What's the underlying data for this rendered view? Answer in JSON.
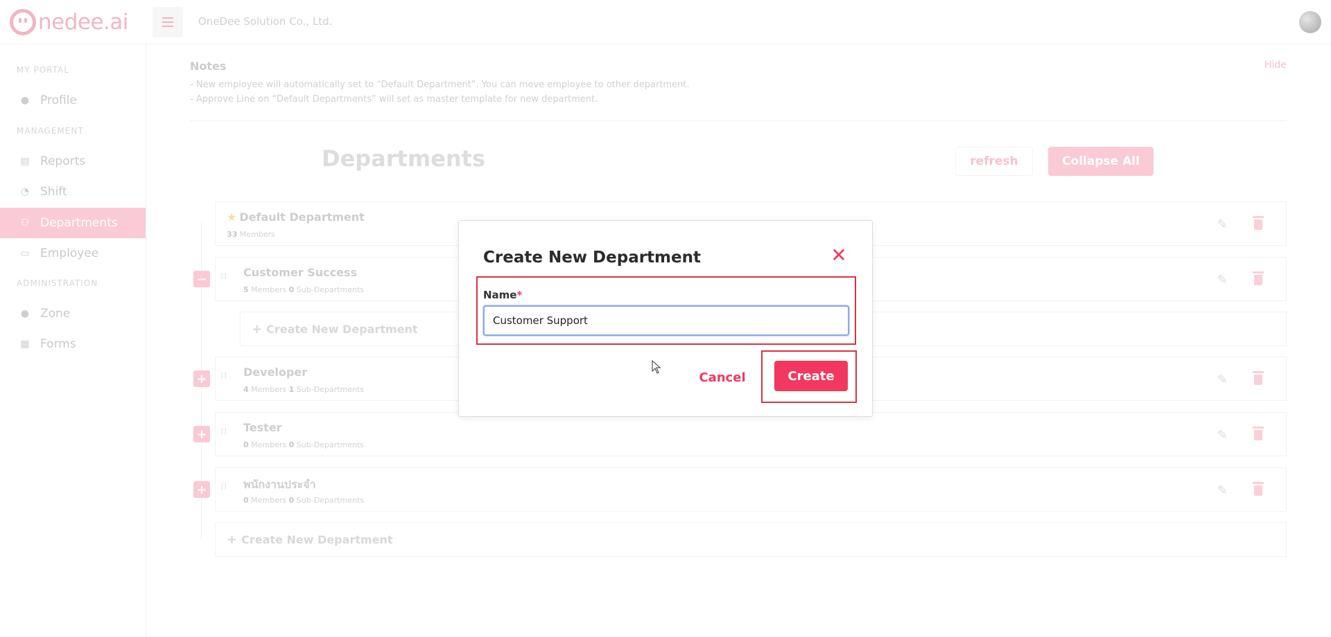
{
  "topbar": {
    "logo_text": "nedee.ai",
    "company_name": "OneDee Solution Co., Ltd."
  },
  "sidebar": {
    "sections": [
      {
        "label": "MY PORTAL",
        "items": [
          {
            "label": "Profile",
            "icon": "user-circle-icon"
          }
        ]
      },
      {
        "label": "MANAGEMENT",
        "items": [
          {
            "label": "Reports",
            "icon": "document-icon"
          },
          {
            "label": "Shift",
            "icon": "shift-icon"
          },
          {
            "label": "Departments",
            "icon": "users-icon",
            "active": true
          },
          {
            "label": "Employee",
            "icon": "id-card-icon"
          }
        ]
      },
      {
        "label": "ADMINISTRATION",
        "items": [
          {
            "label": "Zone",
            "icon": "pin-icon"
          },
          {
            "label": "Forms",
            "icon": "clipboard-icon"
          }
        ]
      }
    ]
  },
  "notes": {
    "title": "Notes",
    "hide_label": "Hide",
    "lines": [
      "- New employee will automatically set to “Default Department”. You can move employee to other department.",
      "- Approve Line on “Default Departments” will set as master template for new department."
    ]
  },
  "departments": {
    "heading": "Departments",
    "refresh_label": "refresh",
    "collapse_all_label": "Collapse All",
    "default": {
      "name": "Default Department",
      "members": "33",
      "members_label": "Members"
    },
    "rows": [
      {
        "name": "Customer Success",
        "members": "5",
        "sub": "0",
        "expanded": true
      },
      {
        "name": "Developer",
        "members": "4",
        "sub": "1",
        "expanded": false
      },
      {
        "name": "Tester",
        "members": "0",
        "sub": "0",
        "expanded": false
      },
      {
        "name": "พนักงานประจำ",
        "members": "0",
        "sub": "0",
        "expanded": false
      }
    ],
    "members_label": "Members",
    "sub_label": "Sub-Departments",
    "create_new_label": "Create New Department"
  },
  "modal": {
    "title": "Create New Department",
    "name_label": "Name",
    "required_mark": "*",
    "name_value": "Customer Support",
    "cancel_label": "Cancel",
    "create_label": "Create"
  },
  "colors": {
    "accent": "#f2385e",
    "accent_dimmed": "#f9c1ce",
    "highlight_box": "#d6343e"
  }
}
